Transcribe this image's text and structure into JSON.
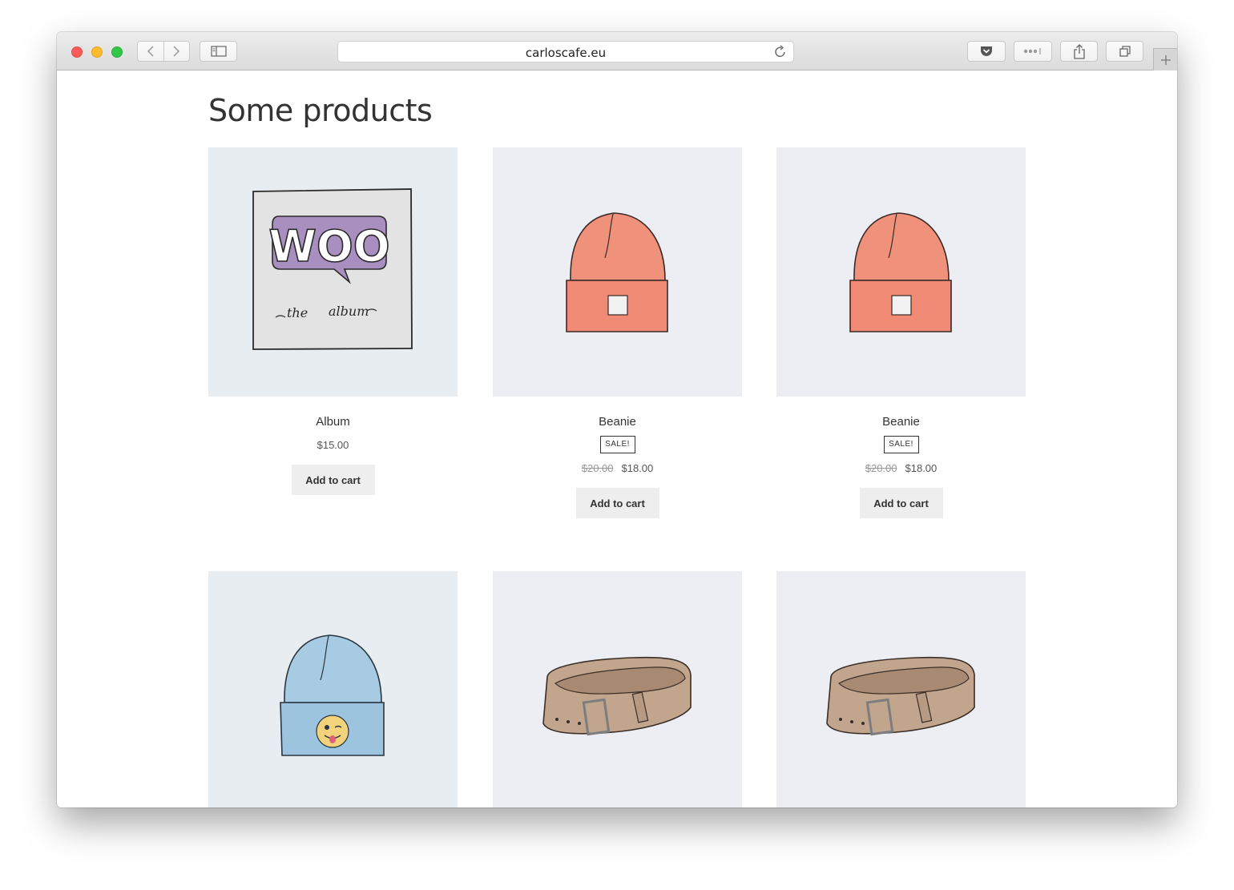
{
  "browser": {
    "url": "carloscafe.eu",
    "icons": {
      "back": "chevron-left-icon",
      "forward": "chevron-right-icon",
      "sidebar": "sidebar-icon",
      "reload": "reload-icon",
      "pocket": "pocket-icon",
      "more": "more-icon",
      "share": "share-icon",
      "tabs": "tabs-overview-icon",
      "new_tab": "plus-icon"
    }
  },
  "page": {
    "title": "Some products"
  },
  "products": [
    {
      "name": "Album",
      "price": "$15.00",
      "sale": false,
      "button": "Add to cart",
      "image": "woo-album-cover"
    },
    {
      "name": "Beanie",
      "badge": "SALE!",
      "old_price": "$20.00",
      "price": "$18.00",
      "sale": true,
      "button": "Add to cart",
      "image": "orange-beanie"
    },
    {
      "name": "Beanie",
      "badge": "SALE!",
      "old_price": "$20.00",
      "price": "$18.00",
      "sale": true,
      "button": "Add to cart",
      "image": "orange-beanie"
    },
    {
      "image": "blue-beanie-with-emoji"
    },
    {
      "image": "belt"
    },
    {
      "image": "belt"
    }
  ],
  "colors": {
    "thumb_bg": "#e8edf2",
    "beanie_orange": "#f0917c",
    "beanie_blue": "#a6cbe3",
    "woo_purple": "#a88fbf",
    "belt_tan": "#c2a58d",
    "button_bg": "#eeeeee"
  }
}
